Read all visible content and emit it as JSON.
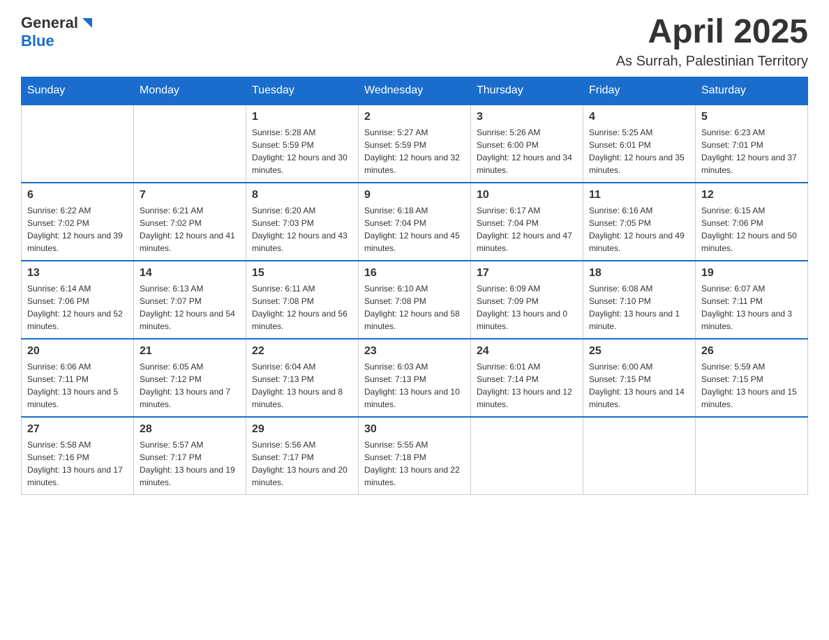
{
  "header": {
    "logo_general": "General",
    "logo_blue": "Blue",
    "month_title": "April 2025",
    "location": "As Surrah, Palestinian Territory"
  },
  "weekdays": [
    "Sunday",
    "Monday",
    "Tuesday",
    "Wednesday",
    "Thursday",
    "Friday",
    "Saturday"
  ],
  "weeks": [
    [
      {
        "day": "",
        "sunrise": "",
        "sunset": "",
        "daylight": ""
      },
      {
        "day": "",
        "sunrise": "",
        "sunset": "",
        "daylight": ""
      },
      {
        "day": "1",
        "sunrise": "Sunrise: 5:28 AM",
        "sunset": "Sunset: 5:59 PM",
        "daylight": "Daylight: 12 hours and 30 minutes."
      },
      {
        "day": "2",
        "sunrise": "Sunrise: 5:27 AM",
        "sunset": "Sunset: 5:59 PM",
        "daylight": "Daylight: 12 hours and 32 minutes."
      },
      {
        "day": "3",
        "sunrise": "Sunrise: 5:26 AM",
        "sunset": "Sunset: 6:00 PM",
        "daylight": "Daylight: 12 hours and 34 minutes."
      },
      {
        "day": "4",
        "sunrise": "Sunrise: 5:25 AM",
        "sunset": "Sunset: 6:01 PM",
        "daylight": "Daylight: 12 hours and 35 minutes."
      },
      {
        "day": "5",
        "sunrise": "Sunrise: 6:23 AM",
        "sunset": "Sunset: 7:01 PM",
        "daylight": "Daylight: 12 hours and 37 minutes."
      }
    ],
    [
      {
        "day": "6",
        "sunrise": "Sunrise: 6:22 AM",
        "sunset": "Sunset: 7:02 PM",
        "daylight": "Daylight: 12 hours and 39 minutes."
      },
      {
        "day": "7",
        "sunrise": "Sunrise: 6:21 AM",
        "sunset": "Sunset: 7:02 PM",
        "daylight": "Daylight: 12 hours and 41 minutes."
      },
      {
        "day": "8",
        "sunrise": "Sunrise: 6:20 AM",
        "sunset": "Sunset: 7:03 PM",
        "daylight": "Daylight: 12 hours and 43 minutes."
      },
      {
        "day": "9",
        "sunrise": "Sunrise: 6:18 AM",
        "sunset": "Sunset: 7:04 PM",
        "daylight": "Daylight: 12 hours and 45 minutes."
      },
      {
        "day": "10",
        "sunrise": "Sunrise: 6:17 AM",
        "sunset": "Sunset: 7:04 PM",
        "daylight": "Daylight: 12 hours and 47 minutes."
      },
      {
        "day": "11",
        "sunrise": "Sunrise: 6:16 AM",
        "sunset": "Sunset: 7:05 PM",
        "daylight": "Daylight: 12 hours and 49 minutes."
      },
      {
        "day": "12",
        "sunrise": "Sunrise: 6:15 AM",
        "sunset": "Sunset: 7:06 PM",
        "daylight": "Daylight: 12 hours and 50 minutes."
      }
    ],
    [
      {
        "day": "13",
        "sunrise": "Sunrise: 6:14 AM",
        "sunset": "Sunset: 7:06 PM",
        "daylight": "Daylight: 12 hours and 52 minutes."
      },
      {
        "day": "14",
        "sunrise": "Sunrise: 6:13 AM",
        "sunset": "Sunset: 7:07 PM",
        "daylight": "Daylight: 12 hours and 54 minutes."
      },
      {
        "day": "15",
        "sunrise": "Sunrise: 6:11 AM",
        "sunset": "Sunset: 7:08 PM",
        "daylight": "Daylight: 12 hours and 56 minutes."
      },
      {
        "day": "16",
        "sunrise": "Sunrise: 6:10 AM",
        "sunset": "Sunset: 7:08 PM",
        "daylight": "Daylight: 12 hours and 58 minutes."
      },
      {
        "day": "17",
        "sunrise": "Sunrise: 6:09 AM",
        "sunset": "Sunset: 7:09 PM",
        "daylight": "Daylight: 13 hours and 0 minutes."
      },
      {
        "day": "18",
        "sunrise": "Sunrise: 6:08 AM",
        "sunset": "Sunset: 7:10 PM",
        "daylight": "Daylight: 13 hours and 1 minute."
      },
      {
        "day": "19",
        "sunrise": "Sunrise: 6:07 AM",
        "sunset": "Sunset: 7:11 PM",
        "daylight": "Daylight: 13 hours and 3 minutes."
      }
    ],
    [
      {
        "day": "20",
        "sunrise": "Sunrise: 6:06 AM",
        "sunset": "Sunset: 7:11 PM",
        "daylight": "Daylight: 13 hours and 5 minutes."
      },
      {
        "day": "21",
        "sunrise": "Sunrise: 6:05 AM",
        "sunset": "Sunset: 7:12 PM",
        "daylight": "Daylight: 13 hours and 7 minutes."
      },
      {
        "day": "22",
        "sunrise": "Sunrise: 6:04 AM",
        "sunset": "Sunset: 7:13 PM",
        "daylight": "Daylight: 13 hours and 8 minutes."
      },
      {
        "day": "23",
        "sunrise": "Sunrise: 6:03 AM",
        "sunset": "Sunset: 7:13 PM",
        "daylight": "Daylight: 13 hours and 10 minutes."
      },
      {
        "day": "24",
        "sunrise": "Sunrise: 6:01 AM",
        "sunset": "Sunset: 7:14 PM",
        "daylight": "Daylight: 13 hours and 12 minutes."
      },
      {
        "day": "25",
        "sunrise": "Sunrise: 6:00 AM",
        "sunset": "Sunset: 7:15 PM",
        "daylight": "Daylight: 13 hours and 14 minutes."
      },
      {
        "day": "26",
        "sunrise": "Sunrise: 5:59 AM",
        "sunset": "Sunset: 7:15 PM",
        "daylight": "Daylight: 13 hours and 15 minutes."
      }
    ],
    [
      {
        "day": "27",
        "sunrise": "Sunrise: 5:58 AM",
        "sunset": "Sunset: 7:16 PM",
        "daylight": "Daylight: 13 hours and 17 minutes."
      },
      {
        "day": "28",
        "sunrise": "Sunrise: 5:57 AM",
        "sunset": "Sunset: 7:17 PM",
        "daylight": "Daylight: 13 hours and 19 minutes."
      },
      {
        "day": "29",
        "sunrise": "Sunrise: 5:56 AM",
        "sunset": "Sunset: 7:17 PM",
        "daylight": "Daylight: 13 hours and 20 minutes."
      },
      {
        "day": "30",
        "sunrise": "Sunrise: 5:55 AM",
        "sunset": "Sunset: 7:18 PM",
        "daylight": "Daylight: 13 hours and 22 minutes."
      },
      {
        "day": "",
        "sunrise": "",
        "sunset": "",
        "daylight": ""
      },
      {
        "day": "",
        "sunrise": "",
        "sunset": "",
        "daylight": ""
      },
      {
        "day": "",
        "sunrise": "",
        "sunset": "",
        "daylight": ""
      }
    ]
  ]
}
